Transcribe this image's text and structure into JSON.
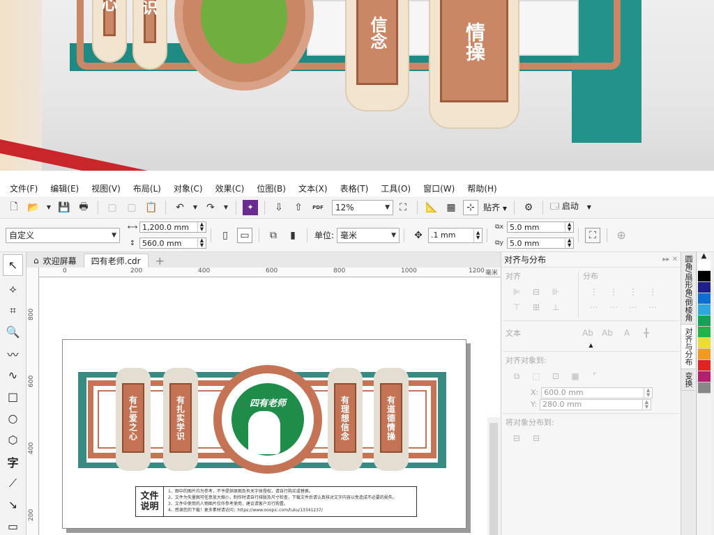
{
  "photo": {
    "plaques": [
      {
        "text": "心"
      },
      {
        "text": "识"
      },
      {
        "text": "信念"
      },
      {
        "text": "情操"
      }
    ]
  },
  "menu": [
    "文件(F)",
    "编辑(E)",
    "视图(V)",
    "布局(L)",
    "对象(C)",
    "效果(C)",
    "位图(B)",
    "文本(X)",
    "表格(T)",
    "工具(O)",
    "窗口(W)",
    "帮助(H)"
  ],
  "toolbar": {
    "zoom": "12%",
    "snap_label": "贴齐",
    "launch_label": "启动",
    "pdf_label": "PDF"
  },
  "propbar": {
    "page_preset": "自定义",
    "width": "1,200.0 mm",
    "height": "560.0 mm",
    "unit_label": "单位:",
    "unit": "毫米",
    "nudge": ".1 mm",
    "dup_x": "5.0 mm",
    "dup_y": "5.0 mm"
  },
  "tabs": {
    "welcome": "欢迎屏幕",
    "doc": "四有老师.cdr"
  },
  "ruler": {
    "h": [
      "0",
      "200",
      "400",
      "600",
      "800",
      "1000",
      "1200"
    ],
    "unit": "毫米",
    "v": [
      "800",
      "600",
      "400",
      "200"
    ]
  },
  "design": {
    "title": "四有老师",
    "plaques": [
      "有仁爱之心",
      "有扎实学识",
      "有理想信念",
      "有道德情操"
    ],
    "notes_heading_1": "文件",
    "notes_heading_2": "说明",
    "notes": [
      "1、图中的图片均为参考，不予提供原图及有关字体授权，请自行购买或替换。",
      "2、文件为矢量图可任意放大缩小，制作时请自行排版及尺寸检查，下载文件后请认真核对文字内容以免造成不必要的损失。",
      "3、文件中使用的人物图片仅作参考使用，建议请客户另行购置。",
      "4、感谢您的下载！更多素材请访问：https://www.ooopic.com/tuku/13341237/"
    ]
  },
  "docker": {
    "title": "对齐与分布",
    "align": "对齐",
    "distribute": "分布",
    "text": "文本",
    "align_to": "对齐对象到:",
    "x_label": "X:",
    "x_value": "600.0 mm",
    "y_label": "Y:",
    "y_value": "280.0 mm",
    "distribute_to": "将对象分布到:"
  },
  "sidetabs": [
    "圆角/扇形角/倒棱角",
    "对齐与分布",
    "变换"
  ],
  "palette": [
    "#ffffff",
    "#000000",
    "#1f1f8a",
    "#0a6fd0",
    "#2ea6e0",
    "#18a058",
    "#1fb34a",
    "#e8e02a",
    "#f29a1f",
    "#e02424",
    "#b51f6e",
    "#888888"
  ]
}
